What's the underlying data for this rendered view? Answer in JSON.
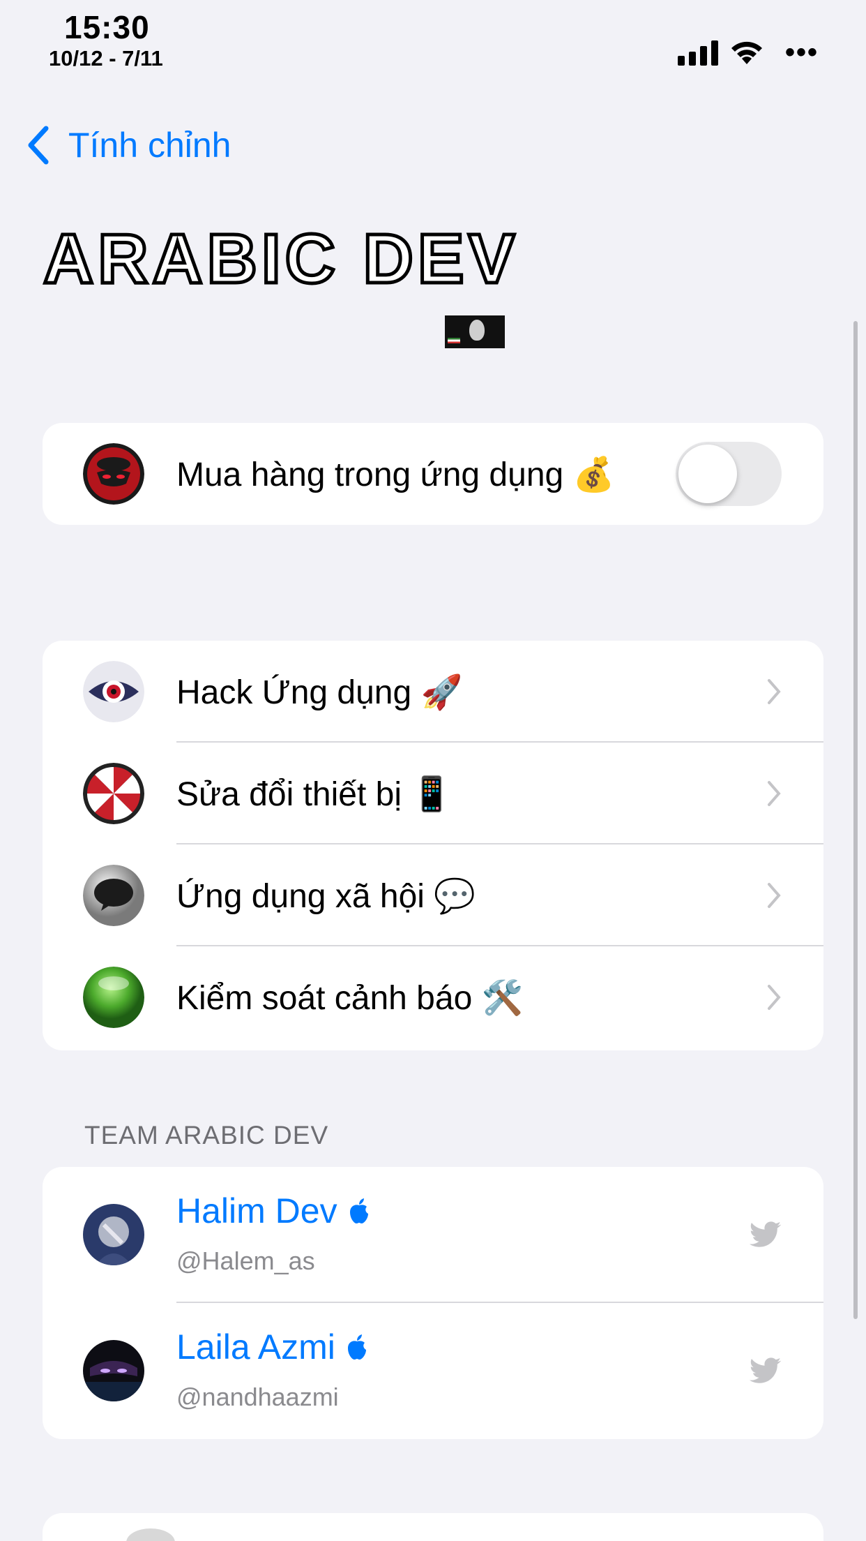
{
  "status_bar": {
    "time": "15:30",
    "date": "10/12 - 7/11",
    "more": "•••"
  },
  "nav": {
    "back_label": "Tính chỉnh"
  },
  "header": {
    "title": "ARABIC DEV"
  },
  "purchase": {
    "label": "Mua hàng trong ứng dụng 💰",
    "toggle_on": false
  },
  "menu": {
    "items": [
      {
        "label": "Hack Ứng dụng 🚀",
        "icon": "eye-icon"
      },
      {
        "label": "Sửa đổi thiết bị 📱",
        "icon": "umbrella-icon"
      },
      {
        "label": "Ứng dụng xã hội 💬",
        "icon": "chat-bubble-icon"
      },
      {
        "label": "Kiểm soát cảnh báo 🛠️",
        "icon": "green-orb-icon"
      }
    ]
  },
  "team": {
    "header": "TEAM ARABIC DEV",
    "members": [
      {
        "name": "Halim Dev",
        "handle": "@Halem_as"
      },
      {
        "name": "Laila Azmi",
        "handle": "@nandhaazmi"
      }
    ]
  },
  "colors": {
    "accent": "#007aff",
    "background": "#f2f2f7",
    "secondary_text": "#8a8a8e"
  }
}
